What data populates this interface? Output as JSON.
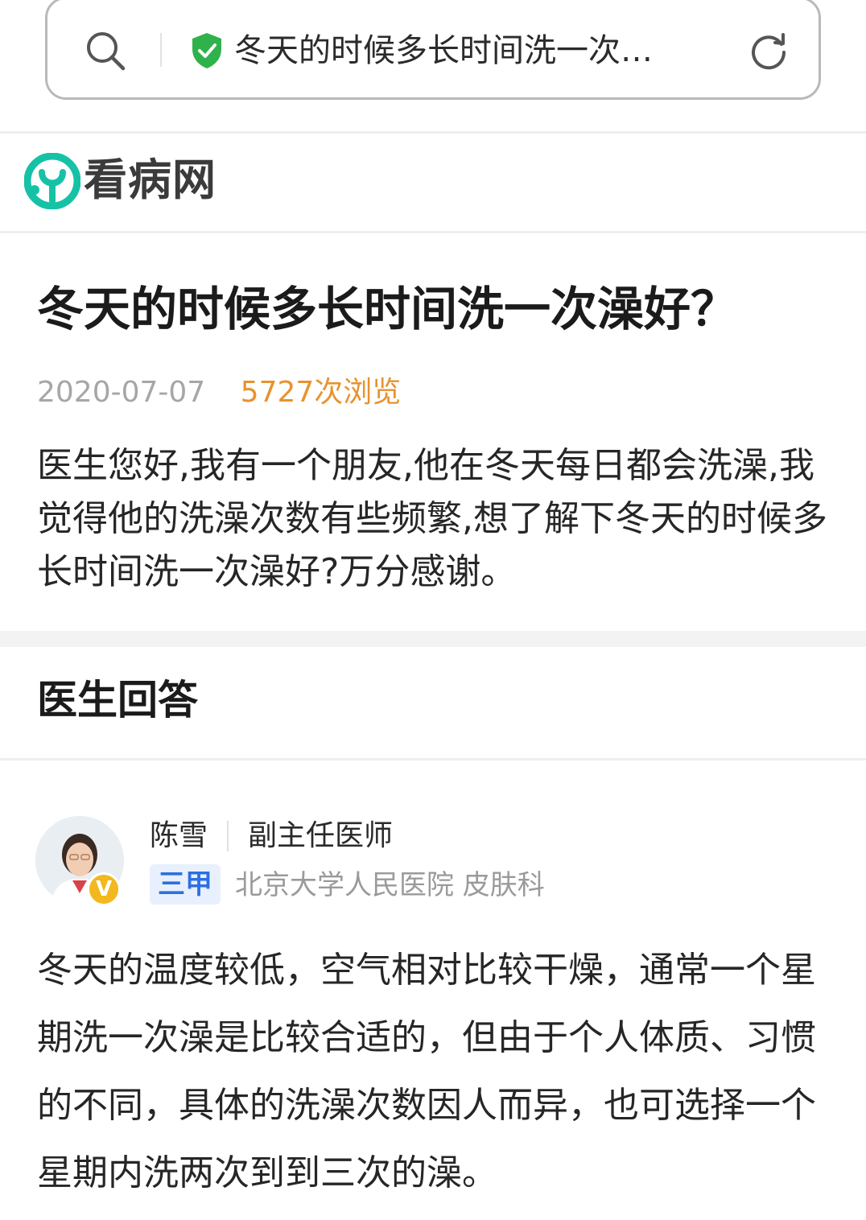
{
  "address_bar": {
    "title": "冬天的时候多长时间洗一次…",
    "search_icon": "search-icon",
    "secure_icon": "shield-check-icon",
    "reload_icon": "reload-icon",
    "secure_color": "#2fb24b"
  },
  "site": {
    "name": "看病网",
    "logo_icon": "kanbing-logo-icon",
    "brand_color": "#16c2a6"
  },
  "question": {
    "title": "冬天的时候多长时间洗一次澡好？",
    "date": "2020-07-07",
    "views": "5727次浏览",
    "body": "医生您好,我有一个朋友,他在冬天每日都会洗澡,我觉得他的洗澡次数有些频繁,想了解下冬天的时候多长时间洗一次澡好?万分感谢。"
  },
  "answer_section": {
    "heading": "医生回答"
  },
  "doctor": {
    "name": "陈雪",
    "title": "副主任医师",
    "grade": "三甲",
    "hospital": "北京大学人民医院 皮肤科",
    "verified_badge": "V"
  },
  "answer": {
    "body": "冬天的温度较低，空气相对比较干燥，通常一个星期洗一次澡是比较合适的，但由于个人体质、习惯的不同，具体的洗澡次数因人而异，也可选择一个星期内洗两次到到三次的澡。"
  }
}
